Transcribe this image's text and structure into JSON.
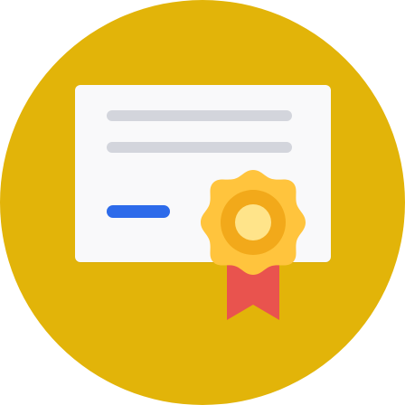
{
  "icon": {
    "name": "certificate-icon",
    "colors": {
      "background_circle": "#E2B409",
      "card": "#F9F9FA",
      "text_lines": "#D3D5DC",
      "signature": "#2D6BEA",
      "seal_outer": "#FFC43D",
      "seal_ring": "#F2A91A",
      "seal_center": "#FFE48A",
      "ribbon": "#E9534E"
    }
  }
}
